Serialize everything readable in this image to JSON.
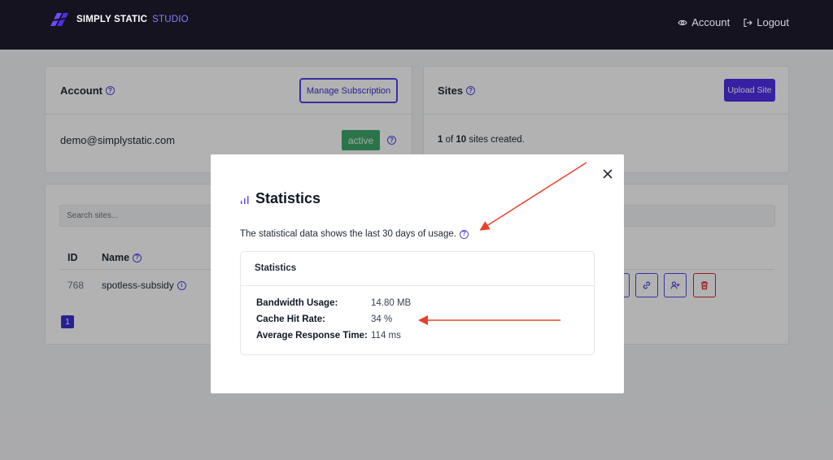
{
  "header": {
    "brand": "SIMPLY STATIC",
    "brand_accent": "STUDIO",
    "nav": [
      {
        "label": "Account",
        "icon": "eye-icon"
      },
      {
        "label": "Logout",
        "icon": "logout-icon"
      }
    ]
  },
  "account_card": {
    "title": "Account",
    "manage_button": "Manage Subscription",
    "email": "demo@simplystatic.com",
    "status": "active"
  },
  "sites_card": {
    "title": "Sites",
    "upload_button": "Upload Site",
    "count_current": "1",
    "count_of": "of",
    "count_max": "10",
    "count_suffix": "sites created."
  },
  "sites_table": {
    "search_placeholder": "Search sites...",
    "columns": [
      "ID",
      "Name"
    ],
    "rows": [
      {
        "id": "768",
        "name": "spotless-subsidy"
      }
    ],
    "pagination": {
      "current": "1"
    }
  },
  "modal": {
    "title": "Statistics",
    "description": "The statistical data shows the last 30 days of usage.",
    "box_title": "Statistics",
    "stats": [
      {
        "label": "Bandwidth Usage:",
        "value": "14.80 MB"
      },
      {
        "label": "Cache Hit Rate:",
        "value": "34 %"
      },
      {
        "label": "Average Response Time:",
        "value": "114 ms"
      }
    ]
  },
  "colors": {
    "accent": "#4f46e5",
    "header_bg": "#14131f",
    "active_badge": "#3ea66b",
    "annotation_arrow": "#e5432b"
  }
}
